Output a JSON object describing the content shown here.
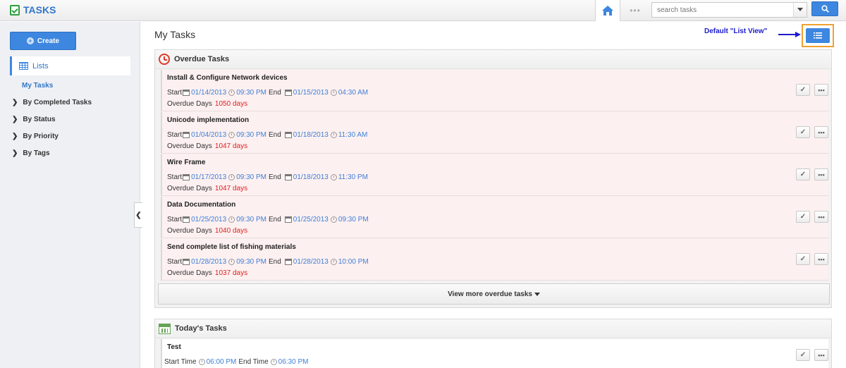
{
  "app": {
    "title": "TASKS"
  },
  "header": {
    "dots": "•••",
    "search_placeholder": "search tasks"
  },
  "sidebar": {
    "create_label": "Create",
    "lists_label": "Lists",
    "my_tasks_label": "My Tasks",
    "items": [
      {
        "label": "By Completed Tasks"
      },
      {
        "label": "By Status"
      },
      {
        "label": "By Priority"
      },
      {
        "label": "By Tags"
      }
    ]
  },
  "main": {
    "page_title": "My Tasks",
    "annotation": "Default \"List View\""
  },
  "overdue": {
    "title": "Overdue Tasks",
    "start_label": "Start",
    "end_label": "End",
    "overdue_label": "Overdue Days",
    "tasks": [
      {
        "title": "Install & Configure Network devices",
        "start_date": "01/14/2013",
        "start_time": "09:30 PM",
        "end_date": "01/15/2013",
        "end_time": "04:30 AM",
        "days": "1050 days"
      },
      {
        "title": "Unicode implementation",
        "start_date": "01/04/2013",
        "start_time": "09:30 PM",
        "end_date": "01/18/2013",
        "end_time": "11:30 AM",
        "days": "1047 days"
      },
      {
        "title": "Wire Frame",
        "start_date": "01/17/2013",
        "start_time": "09:30 PM",
        "end_date": "01/18/2013",
        "end_time": "11:30 PM",
        "days": "1047 days"
      },
      {
        "title": "Data Documentation",
        "start_date": "01/25/2013",
        "start_time": "09:30 PM",
        "end_date": "01/25/2013",
        "end_time": "09:30 PM",
        "days": "1040 days"
      },
      {
        "title": "Send complete list of fishing materials",
        "start_date": "01/28/2013",
        "start_time": "09:30 PM",
        "end_date": "01/28/2013",
        "end_time": "10:00 PM",
        "days": "1037 days"
      }
    ],
    "view_more_label": "View more overdue tasks"
  },
  "today": {
    "title": "Today's Tasks",
    "start_time_label": "Start Time",
    "end_time_label": "End Time",
    "tasks": [
      {
        "title": "Test",
        "start_time": "06:00 PM",
        "end_time": "06:30 PM"
      }
    ]
  },
  "colors": {
    "accent": "#3d87e0",
    "overdue_bg": "#fdf0f0",
    "overdue_days": "#e02020",
    "annotation": "#1b1bcc",
    "highlight": "#f0a030"
  }
}
